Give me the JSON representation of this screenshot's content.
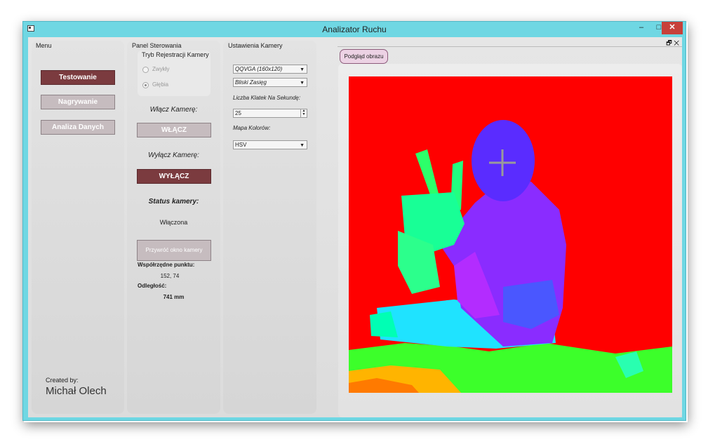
{
  "window": {
    "title": "Analizator Ruchu",
    "min": "–",
    "max": "□",
    "close": "✕"
  },
  "menu": {
    "label": "Menu",
    "buttons": [
      "Testowanie",
      "Nagrywanie",
      "Analiza Danych"
    ],
    "created_by": "Created by:",
    "author": "Michał Olech"
  },
  "control": {
    "label": "Panel Sterowania",
    "mode_title": "Tryb Rejestracji Kamery",
    "modes": [
      "Zwykły",
      "Głębia"
    ],
    "selected_mode": "Głębia",
    "on_label": "Włącz Kamerę:",
    "on_button": "WŁĄCZ",
    "off_label": "Wyłącz Kamerę:",
    "off_button": "WYŁĄCZ",
    "status_label": "Status kamery:",
    "status_value": "Włączona",
    "restore_button": "Przywróć okno kamery",
    "coords_label": "Współrzędne punktu:",
    "coords_value": "152, 74",
    "distance_label": "Odległość:",
    "distance_value": "741 mm"
  },
  "camera": {
    "label": "Ustawienia Kamery",
    "resolution": "QQVGA (160x120)",
    "range": "Bliski Zasięg",
    "fps_label": "Liczba Klatek Na Sekundę:",
    "fps": "25",
    "colormap_label": "Mapa Kolorów:",
    "colormap": "HSV"
  },
  "preview": {
    "dock_icons": "🗗 ✕",
    "tab": "Podgląd obrazu"
  },
  "colors": {
    "accent": "#7b3b3f",
    "button": "#c6bcbf",
    "frame": "#6fd7e3",
    "depth_background": "#ff0000"
  }
}
